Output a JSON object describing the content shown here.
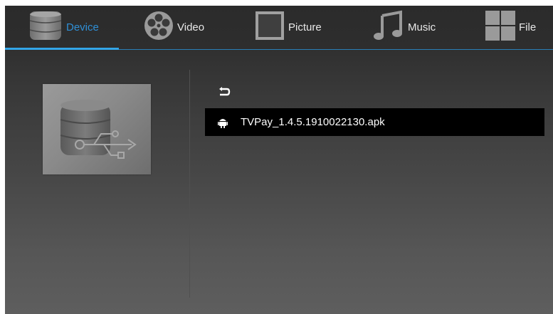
{
  "tabs": [
    {
      "label": "Device",
      "icon": "database-icon",
      "active": true
    },
    {
      "label": "Video",
      "icon": "film-reel-icon",
      "active": false
    },
    {
      "label": "Picture",
      "icon": "picture-frame-icon",
      "active": false
    },
    {
      "label": "Music",
      "icon": "music-note-icon",
      "active": false
    },
    {
      "label": "File",
      "icon": "grid-icon",
      "active": false
    }
  ],
  "colors": {
    "accent": "#33a6e8",
    "active_tab_text": "#2f8fd6",
    "selected_row": "#000000"
  },
  "device_panel": {
    "icon": "usb-storage-icon"
  },
  "file_list": {
    "back_icon": "return-arrow-icon",
    "items": [
      {
        "name": "TVPay_1.4.5.1910022130.apk",
        "icon": "android-icon",
        "selected": true
      }
    ]
  }
}
